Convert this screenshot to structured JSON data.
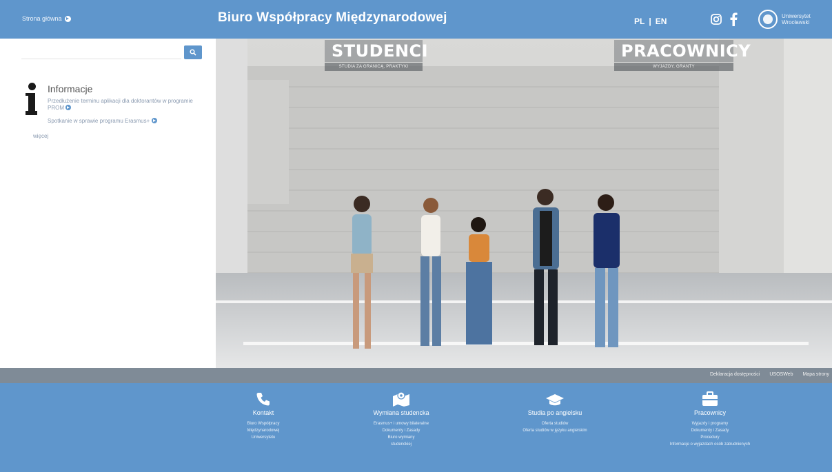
{
  "topbar": {
    "home_link": "Strona główna",
    "site_title": "Biuro Współpracy Międzynarodowej",
    "lang_pl": "PL",
    "lang_sep": "|",
    "lang_en": "EN",
    "university_line1": "Uniwersytet",
    "university_line2": "Wrocławski",
    "accent_color": "#5f96cc"
  },
  "sidebar": {
    "search_placeholder": "",
    "info_heading": "Informacje",
    "links": [
      "Przedłużenie terminu aplikacji dla doktorantów w programie PROM",
      "Spotkanie w sprawie programu Erasmus+"
    ],
    "more_label": "więcej"
  },
  "hero": {
    "students_title": "STUDENCI",
    "students_subtitle": "STUDIA ZA GRANICĄ, PRAKTYKI",
    "staff_title": "PRACOWNICY",
    "staff_subtitle": "WYJAZDY, GRANTY"
  },
  "strip": {
    "links": [
      "Deklaracja dostępności",
      "USOSWeb",
      "Mapa strony"
    ]
  },
  "footer": {
    "columns": [
      {
        "icon": "phone-icon",
        "title": "Kontakt",
        "items": [
          "Biuro Współpracy",
          "Międzynarodowej",
          "Uniwersytetu"
        ]
      },
      {
        "icon": "map-icon",
        "title": "Wymiana studencka",
        "items": [
          "Erasmus+ i umowy bilateralne",
          "Dokumenty i Zasady",
          "Biuro wymiany",
          "studenckiej"
        ]
      },
      {
        "icon": "graduation-cap-icon",
        "title": "Studia po angielsku",
        "items": [
          "Oferta studiów",
          "Oferta studiów w języku angielskim"
        ]
      },
      {
        "icon": "briefcase-icon",
        "title": "Pracownicy",
        "items": [
          "Wyjazdy i programy",
          "Dokumenty i Zasady",
          "Procedury",
          "Informacje o wyjazdach osób zatrudnionych"
        ]
      }
    ]
  }
}
